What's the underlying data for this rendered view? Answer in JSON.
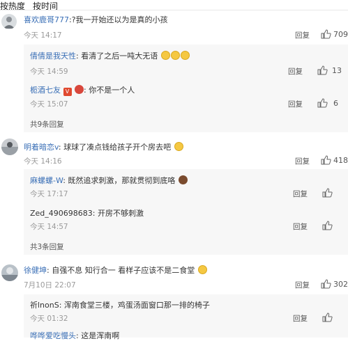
{
  "tabs": {
    "hot": "按热度",
    "time": "按时间"
  },
  "actions": {
    "reply": "回复"
  },
  "comments": [
    {
      "name": "喜欢鹿哥777",
      "text": ":?我一开始还以为是真的小孩",
      "time": "今天 14:17",
      "likes": "709",
      "replies": [
        {
          "name": "倩倩是我天性",
          "text": ": 看清了之后一吨大无语",
          "time": "今天 14:59",
          "likes": "13",
          "emoji": "sweat-smile-emoji x3"
        },
        {
          "name": "栀酒七友",
          "text": ": 你不是一个人",
          "time": "今天 15:07",
          "likes": "6",
          "badge": "V"
        }
      ],
      "more": "共9条回复"
    },
    {
      "name": "明着暗恋v",
      "text": ": 球球了凑点钱给孩子开个房去吧",
      "time": "今天 14:16",
      "likes": "418",
      "replies": [
        {
          "name": "麻螺螺-W",
          "text": ": 既然追求刺激，那就贯彻到底咯",
          "time": "今天 17:17",
          "likes": ""
        },
        {
          "name": "Zed_490698683",
          "text": ": 开房不够刺激",
          "time": "今天 14:57",
          "likes": ""
        }
      ],
      "more": "共3条回复"
    },
    {
      "name": "徐健坤",
      "text": ": 自强不息 知行合一 看样子应该不是二食堂",
      "time": "7月10日 22:07",
      "likes": "302",
      "replies": [
        {
          "name": "祈lnonS",
          "text": ": 浑南食堂三楼，鸡蛋汤面窗口那一排的椅子",
          "time": "今天 01:32",
          "likes": ""
        },
        {
          "name": "哗哗爱吃慢头",
          "text": ": 这是浑南啊",
          "time": "",
          "likes": ""
        }
      ]
    }
  ]
}
